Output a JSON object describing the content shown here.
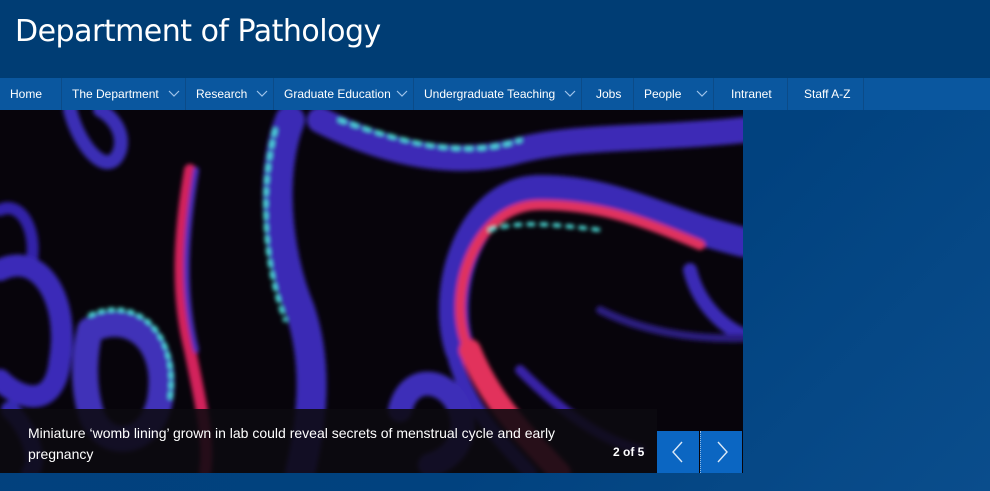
{
  "site": {
    "title": "Department of Pathology"
  },
  "nav": {
    "items": [
      {
        "label": "Home",
        "has_dropdown": false
      },
      {
        "label": "The Department",
        "has_dropdown": true
      },
      {
        "label": "Research",
        "has_dropdown": true
      },
      {
        "label": "Graduate Education",
        "has_dropdown": true
      },
      {
        "label": "Undergraduate Teaching",
        "has_dropdown": true
      },
      {
        "label": "Jobs",
        "has_dropdown": false
      },
      {
        "label": "People",
        "has_dropdown": true
      },
      {
        "label": "Intranet",
        "has_dropdown": false
      },
      {
        "label": "Staff A-Z",
        "has_dropdown": false
      }
    ]
  },
  "carousel": {
    "caption": "Miniature ‘womb lining’ grown in lab could reveal secrets of menstrual cycle and early pregnancy",
    "counter": "2 of 5",
    "prev_icon": "chevron-left-icon",
    "next_icon": "chevron-right-icon"
  },
  "colors": {
    "header_bg": "#003d74",
    "nav_bg": "#0a579f",
    "page_bg": "#023e7a",
    "arrow_bg": "#0b66c2"
  }
}
